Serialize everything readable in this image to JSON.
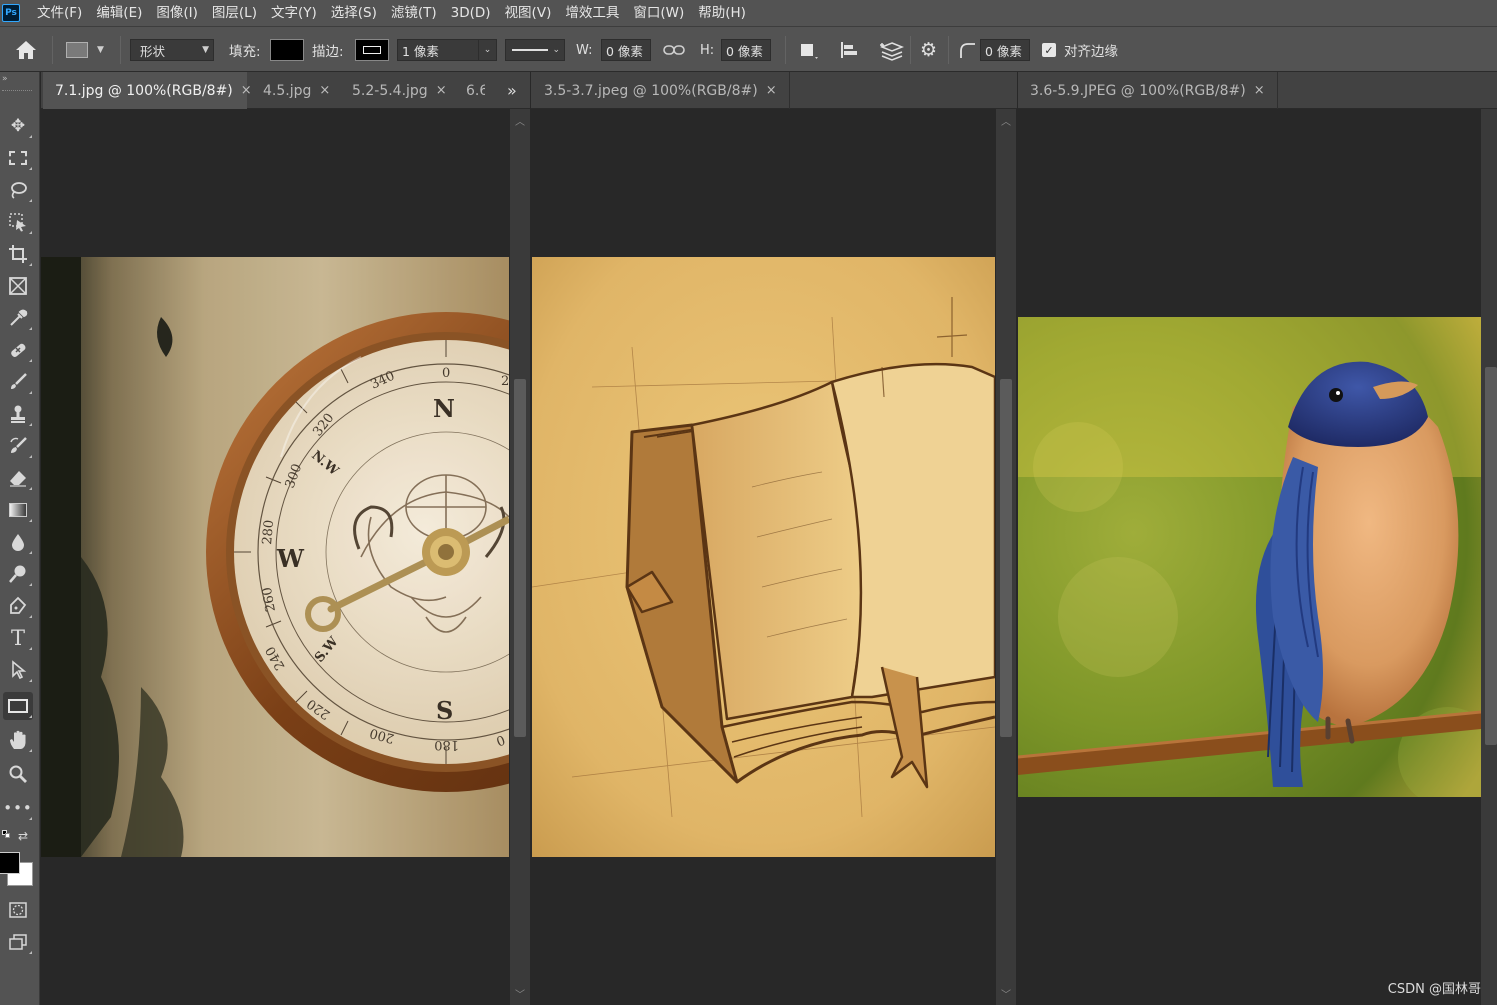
{
  "menubar": {
    "logo": "Ps",
    "items": [
      "文件(F)",
      "编辑(E)",
      "图像(I)",
      "图层(L)",
      "文字(Y)",
      "选择(S)",
      "滤镜(T)",
      "3D(D)",
      "视图(V)",
      "增效工具",
      "窗口(W)",
      "帮助(H)"
    ]
  },
  "options": {
    "mode_value": "形状",
    "fill_label": "填充:",
    "stroke_label": "描边:",
    "stroke_width": "1 像素",
    "w_label": "W:",
    "w_value": "0 像素",
    "h_label": "H:",
    "h_value": "0 像素",
    "radius_value": "0 像素",
    "align_edges_label": "对齐边缘",
    "align_edges_checked": true
  },
  "panes": {
    "left": {
      "tabs": [
        {
          "label": "7.1.jpg @ 100%(RGB/8#)",
          "active": true,
          "close": "×"
        },
        {
          "label": "4.5.jpg",
          "active": false,
          "close": "×"
        },
        {
          "label": "5.2-5.4.jpg",
          "active": false,
          "close": "×"
        },
        {
          "label": "6.6",
          "active": false,
          "close": ""
        }
      ],
      "overflow": "»"
    },
    "middle": {
      "tabs": [
        {
          "label": "3.5-3.7.jpeg @ 100%(RGB/8#)",
          "active": false,
          "close": "×"
        }
      ]
    },
    "right": {
      "tabs": [
        {
          "label": "3.6-5.9.JPEG @ 100%(RGB/8#)",
          "active": false,
          "close": "×"
        }
      ]
    }
  },
  "compass": {
    "north": "N",
    "south": "S",
    "west": "W",
    "nw": "N.W",
    "sw": "S.W",
    "degrees": [
      "340",
      "320",
      "300",
      "280",
      "260",
      "240",
      "220",
      "200",
      "180",
      "0",
      "2",
      "0"
    ]
  },
  "watermark": "CSDN @国林哥",
  "colors": {
    "ui_panel": "#535353",
    "canvas_bg": "#282828",
    "foreground": "#000000",
    "background": "#ffffff"
  }
}
